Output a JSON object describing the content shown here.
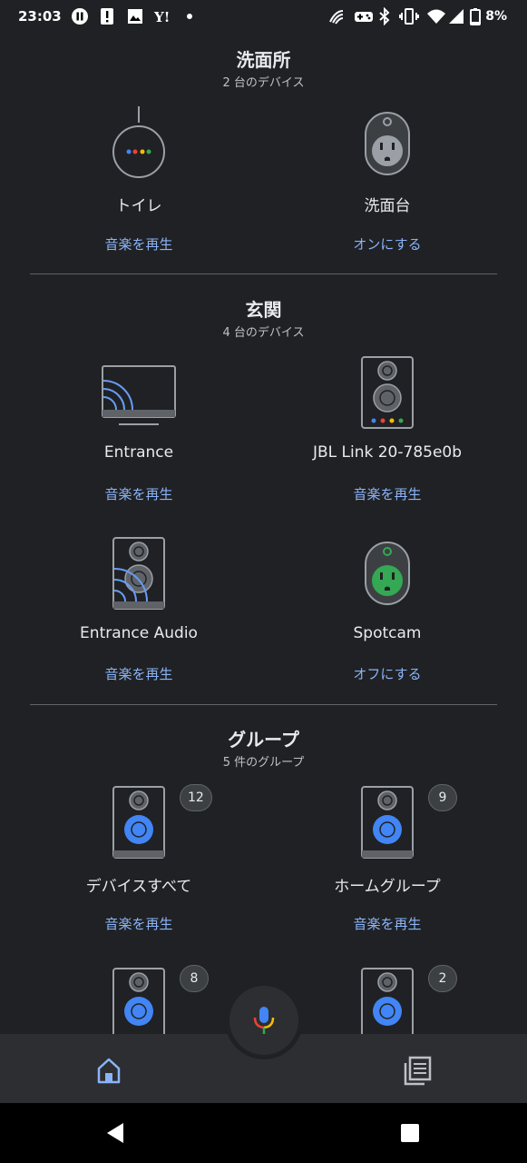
{
  "status_bar": {
    "time": "23:03",
    "battery_percent": "8%",
    "left_icons": [
      "pause-circle-icon",
      "alert-icon",
      "image-icon",
      "yahoo-icon",
      "dot-icon"
    ],
    "right_icons": [
      "nfc-icon",
      "gamepad-icon",
      "bluetooth-icon",
      "vibrate-icon",
      "wifi-icon",
      "signal-icon",
      "battery-icon"
    ]
  },
  "sections": [
    {
      "title": "洗面所",
      "subtitle": "2 台のデバイス",
      "devices": [
        {
          "name": "トイレ",
          "action": "音楽を再生",
          "icon": "google-nest-mini-icon"
        },
        {
          "name": "洗面台",
          "action": "オンにする",
          "icon": "smart-plug-off-icon"
        }
      ]
    },
    {
      "title": "玄関",
      "subtitle": "4 台のデバイス",
      "devices": [
        {
          "name": "Entrance",
          "action": "音楽を再生",
          "icon": "cast-tv-icon"
        },
        {
          "name": "JBL Link 20-785e0b",
          "action": "音楽を再生",
          "icon": "smart-speaker-icon"
        },
        {
          "name": "Entrance Audio",
          "action": "音楽を再生",
          "icon": "cast-speaker-icon"
        },
        {
          "name": "Spotcam",
          "action": "オフにする",
          "icon": "smart-plug-on-icon"
        }
      ]
    },
    {
      "title": "グループ",
      "subtitle": "5 件のグループ",
      "devices": [
        {
          "name": "デバイスすべて",
          "action": "音楽を再生",
          "icon": "speaker-group-icon",
          "count": "12"
        },
        {
          "name": "ホームグループ",
          "action": "音楽を再生",
          "icon": "speaker-group-icon",
          "count": "9"
        },
        {
          "icon": "speaker-group-icon",
          "count": "8"
        },
        {
          "icon": "speaker-group-icon",
          "count": "2"
        }
      ]
    }
  ],
  "bottom_nav": {
    "items": [
      {
        "icon": "home-icon",
        "active": true
      },
      {
        "icon": "feed-icon",
        "active": false
      }
    ],
    "fab_icon": "google-assistant-mic-icon"
  },
  "system_nav": [
    "back-icon",
    "recents-icon"
  ],
  "colors": {
    "background": "#202124",
    "accent": "#8ab4f8",
    "plug_on": "#34a853",
    "speaker_blue": "#4285f4"
  }
}
